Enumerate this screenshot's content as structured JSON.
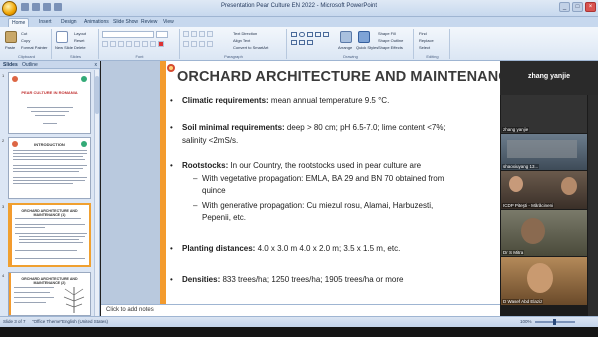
{
  "window": {
    "title": "Presentation Pear Culture EN 2022 - Microsoft PowerPoint"
  },
  "ribbon": {
    "tabs": [
      "Home",
      "Insert",
      "Design",
      "Animations",
      "Slide Show",
      "Review",
      "View"
    ],
    "active_tab": "Home",
    "clipboard": {
      "paste": "Paste",
      "cut": "Cut",
      "copy": "Copy",
      "format_painter": "Format Painter",
      "label": "Clipboard"
    },
    "slides": {
      "new_slide": "New Slide",
      "layout": "Layout",
      "reset": "Reset",
      "delete": "Delete",
      "label": "Slides"
    },
    "font": {
      "label": "Font"
    },
    "paragraph": {
      "text_direction": "Text Direction",
      "align_text": "Align Text",
      "convert_smartart": "Convert to SmartArt",
      "label": "Paragraph"
    },
    "drawing": {
      "arrange": "Arrange",
      "quick_styles": "Quick Styles",
      "label": "Drawing"
    },
    "shape_fill": "Shape Fill",
    "shape_outline": "Shape Outline",
    "shape_effects": "Shape Effects",
    "editing": {
      "find": "Find",
      "replace": "Replace",
      "select": "Select",
      "label": "Editing"
    }
  },
  "left_panel": {
    "tab_slides": "Slides",
    "tab_outline": "Outline",
    "close": "x",
    "thumbs": [
      {
        "num": "1",
        "title": "PEAR CULTURE IN ROMANIA"
      },
      {
        "num": "2",
        "title": "INTRODUCTION"
      },
      {
        "num": "3",
        "title": "ORCHARD ARCHITECTURE AND MAINTENANCE (1)"
      },
      {
        "num": "4",
        "title": "ORCHARD ARCHITECTURE AND MAINTENANCE (2)"
      }
    ]
  },
  "slide": {
    "title": "ORCHARD ARCHITECTURE AND MAINTENANCE",
    "bullets": [
      {
        "label": "Climatic requirements:",
        "text": " mean annual temperature 9.5 °C."
      },
      {
        "label": "Soil minimal requirements:",
        "text": " deep > 80 cm; pH 6.5-7.0; lime content <7%;",
        "text2": "salinity <2mS/s."
      },
      {
        "label": "Rootstocks:",
        "text": " In our Country, the rootstocks used in pear culture are"
      },
      {
        "label": "Planting distances:",
        "text": " 4.0 x 3.0 m 4.0 x 2.0 m; 3.5 x 1.5 m, etc."
      },
      {
        "label": "Densities:",
        "text": " 833 trees/ha; 1250 trees/ha; 1905 trees/ha or more"
      }
    ],
    "subbullets": [
      {
        "text": "With vegetative propagation: EMLA, BA 29 and BN 70 obtained from",
        "text2": "quince"
      },
      {
        "text": "With generative propagation: Cu miezul rosu, Alamai, Harbuzesti,",
        "text2": "Pepenii, etc."
      }
    ]
  },
  "notes": {
    "placeholder": "Click to add notes"
  },
  "status": {
    "slide_info": "Slide 3 of 7",
    "theme": "\"Office Theme\"",
    "language": "English (United States)",
    "zoom": "100%"
  },
  "video": {
    "header_name": "zhang yanjie",
    "tiles": [
      {
        "label": "zhang yanjie",
        "bg": "#3a3a3a"
      },
      {
        "label": "shaoxiuyang 13...",
        "bg": "#4a5a6a"
      },
      {
        "label": "ICDP Piteşti - Mărăcineni",
        "bg": "#5a4a40"
      },
      {
        "label": "Dr S Mitra",
        "bg": "#6a6a5a"
      },
      {
        "label": "D Wasef Abd Elaziz",
        "bg": "#8a6a4a"
      }
    ]
  },
  "colors": {
    "accent_orange": "#f39b2e",
    "ribbon_blue": "#dbe6f4",
    "title_text": "#3a3a3a"
  }
}
